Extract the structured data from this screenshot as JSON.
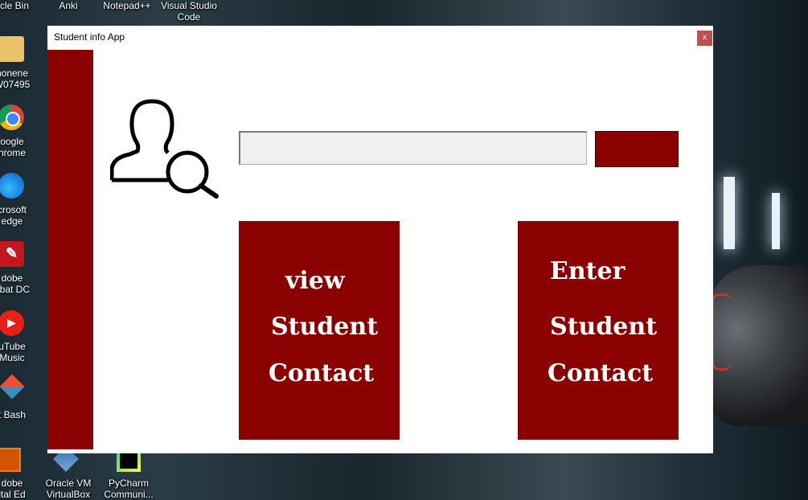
{
  "desktop": {
    "top_icons": [
      {
        "label": "ycle Bin"
      },
      {
        "label": "Anki"
      },
      {
        "label": "Notepad++"
      },
      {
        "label": "Visual Studio Code"
      }
    ],
    "side_icons": [
      {
        "label": "honene\nW07495"
      },
      {
        "label": "oogle\nhrome"
      },
      {
        "label": "crosoft\nedge"
      },
      {
        "label": "dobe\nobat DC"
      },
      {
        "label": "uTube\nMusic"
      },
      {
        "label": "t Bash"
      }
    ],
    "bottom_icons": [
      {
        "label": "dobe\nital Ed"
      },
      {
        "label": "Oracle VM\nVirtualBox"
      },
      {
        "label": "PyCharm\nCommuni..."
      }
    ]
  },
  "window": {
    "title": "Student info App",
    "close_label": "x"
  },
  "search": {
    "value": "",
    "placeholder": ""
  },
  "buttons": {
    "view": {
      "line1": "view",
      "line2": "Student",
      "line3": "Contact"
    },
    "enter": {
      "line1": "Enter",
      "line2": "Student",
      "line3": "Contact"
    }
  },
  "colors": {
    "accent": "#8b0000",
    "close": "#c0504d"
  }
}
